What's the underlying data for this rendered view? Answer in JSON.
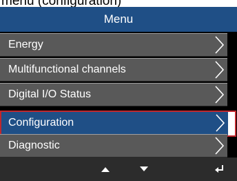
{
  "caption": "menu (configuration)",
  "header": {
    "title": "Menu"
  },
  "menu": {
    "items": [
      {
        "label": "Energy"
      },
      {
        "label": "Multifunctional channels"
      },
      {
        "label": "Digital I/O Status"
      },
      {
        "label": "Configuration",
        "selected": true
      },
      {
        "label": "Diagnostic"
      }
    ]
  },
  "footer": {
    "buttons": [
      {
        "icon": "up-arrow-icon"
      },
      {
        "icon": "down-arrow-icon"
      },
      {
        "icon": "enter-icon"
      }
    ]
  },
  "colors": {
    "header": "#1f4f86",
    "item": "#595959",
    "selected": "#1f4f86",
    "highlight": "#c0272d"
  }
}
